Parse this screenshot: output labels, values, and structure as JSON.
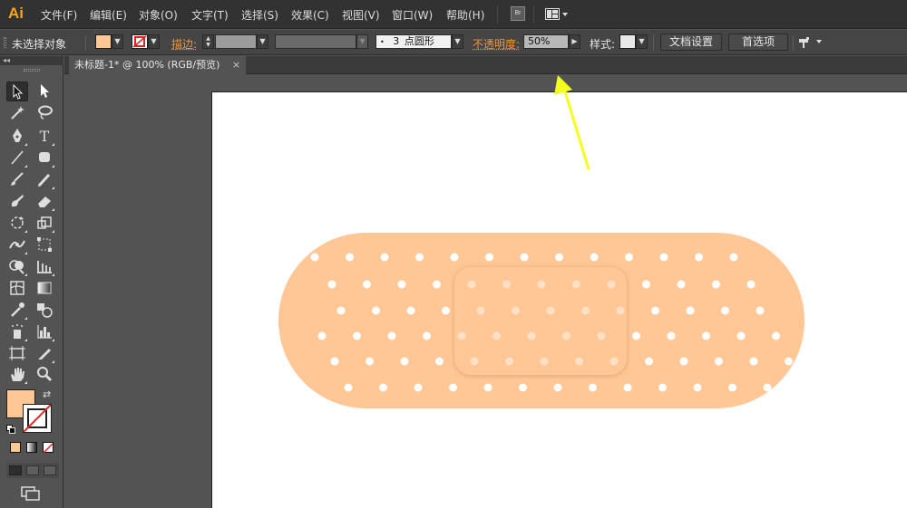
{
  "app": {
    "logo": "Ai",
    "brand_color": "#f7a521"
  },
  "menu": {
    "items": [
      "文件(F)",
      "编辑(E)",
      "对象(O)",
      "文字(T)",
      "选择(S)",
      "效果(C)",
      "视图(V)",
      "窗口(W)",
      "帮助(H)"
    ],
    "bridge_label": "Br"
  },
  "control_bar": {
    "selection_status": "未选择对象",
    "stroke_label": "描边:",
    "brush_size": "3",
    "brush_name": "点圆形",
    "opacity_label": "不透明度:",
    "opacity_value": "50%",
    "style_label": "样式:",
    "doc_setup_button": "文档设置",
    "preferences_button": "首选项",
    "fill_color": "#ffc796"
  },
  "document": {
    "tab_title": "未标题-1* @ 100% (RGB/预览)",
    "close_glyph": "×"
  },
  "toolbox": {
    "collapse_glyph": "◂◂",
    "fill_color": "#ffc796"
  },
  "artwork": {
    "bandage_color": "#ffc796",
    "pad_color": "#ffc796",
    "hole_color": "#ffffff",
    "annotation_arrow_color": "#f5ff1e"
  }
}
